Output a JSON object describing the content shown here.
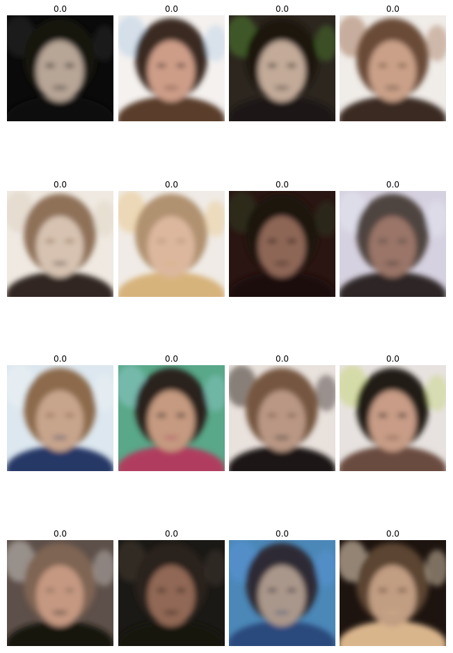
{
  "grid": {
    "rows": 4,
    "cols": 4,
    "cells": [
      {
        "title": "0.0",
        "bg": "#0a0a0a",
        "hair": "#151210",
        "skin": "#b7a596",
        "cloth": "#0d0d0d",
        "accent": "#2a2a2a"
      },
      {
        "title": "0.0",
        "bg": "#f4f1ef",
        "hair": "#3a2a22",
        "skin": "#cd9d88",
        "cloth": "#5a3c2c",
        "accent": "#b9cfe6"
      },
      {
        "title": "0.0",
        "bg": "#2c261f",
        "hair": "#1d1610",
        "skin": "#c3aa99",
        "cloth": "#1b1612",
        "accent": "#4f7f2e"
      },
      {
        "title": "0.0",
        "bg": "#f0ece8",
        "hair": "#6a4b38",
        "skin": "#caa088",
        "cloth": "#3a2b24",
        "accent": "#a57a5f"
      },
      {
        "title": "0.0",
        "bg": "#efe9e1",
        "hair": "#8f7158",
        "skin": "#d7c2b1",
        "cloth": "#302824",
        "accent": "#ded2c2"
      },
      {
        "title": "0.0",
        "bg": "#f0ebe6",
        "hair": "#b0916f",
        "skin": "#dcb79e",
        "cloth": "#d7b37b",
        "accent": "#e9c88e"
      },
      {
        "title": "0.0",
        "bg": "#2a1512",
        "hair": "#1e120e",
        "skin": "#8e6656",
        "cloth": "#1a110e",
        "accent": "#2e3b22"
      },
      {
        "title": "0.0",
        "bg": "#d6d1e0",
        "hair": "#4f4540",
        "skin": "#9a7467",
        "cloth": "#2e2725",
        "accent": "#e4e6f1"
      },
      {
        "title": "0.0",
        "bg": "#dce7ef",
        "hair": "#8c6a4c",
        "skin": "#c7a48c",
        "cloth": "#263866",
        "accent": "#edf2f4"
      },
      {
        "title": "0.0",
        "bg": "#59a889",
        "hair": "#2a211c",
        "skin": "#c59a80",
        "cloth": "#b03c5e",
        "accent": "#8cc7c7"
      },
      {
        "title": "0.0",
        "bg": "#e8e1dc",
        "hair": "#765640",
        "skin": "#b99784",
        "cloth": "#1c1816",
        "accent": "#3a2f2a"
      },
      {
        "title": "0.0",
        "bg": "#e7e2df",
        "hair": "#221a17",
        "skin": "#c89c86",
        "cloth": "#6b4c40",
        "accent": "#c6d57c"
      },
      {
        "title": "0.0",
        "bg": "#5d4f49",
        "hair": "#7f6552",
        "skin": "#c59881",
        "cloth": "#141210",
        "accent": "#c9c5c0"
      },
      {
        "title": "0.0",
        "bg": "#1b1915",
        "hair": "#2b221d",
        "skin": "#916755",
        "cloth": "#141211",
        "accent": "#443932"
      },
      {
        "title": "0.0",
        "bg": "#4b88b8",
        "hair": "#2e2c36",
        "skin": "#aa978b",
        "cloth": "#2a4a7b",
        "accent": "#5a94d6"
      },
      {
        "title": "0.0",
        "bg": "#1e140f",
        "hair": "#5b4532",
        "skin": "#c19d82",
        "cloth": "#d9b58c",
        "accent": "#f2e0c6"
      }
    ]
  }
}
